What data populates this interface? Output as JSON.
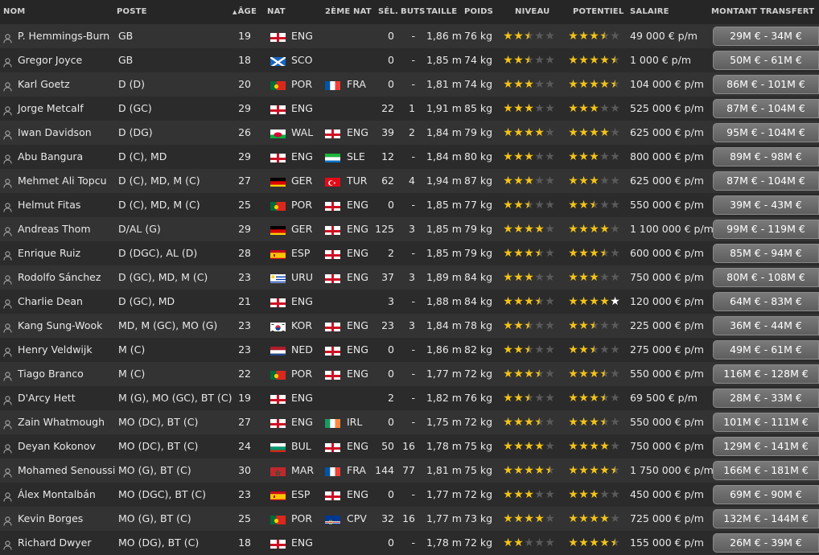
{
  "headers": {
    "nom": "NOM",
    "poste": "POSTE",
    "age": "ÂGE",
    "nat": "NAT",
    "nat2": "2ÈME NAT",
    "sel": "SÉL.",
    "buts": "BUTS",
    "taille": "TAILLE",
    "poids": "POIDS",
    "niveau": "NIVEAU",
    "potentiel": "POTENTIEL",
    "salaire": "SALAIRE",
    "montant": "MONTANT TRANSFERT"
  },
  "colors": {
    "star": "#f3c319",
    "star_empty": "#5a5a5a",
    "row_odd": "#333333",
    "row_even": "#2b2b2b"
  },
  "players": [
    {
      "name": "P. Hemmings-Burn",
      "pos": "GB",
      "age": "19",
      "nat": "ENG",
      "nat2": "",
      "sel": "0",
      "buts": "-",
      "taille": "1,86 m",
      "poids": "76 kg",
      "niveau": 2.5,
      "potentiel": 3.5,
      "salaire": "49 000 € p/m",
      "montant": "29M € - 34M €"
    },
    {
      "name": "Gregor Joyce",
      "pos": "GB",
      "age": "18",
      "nat": "SCO",
      "nat2": "",
      "sel": "0",
      "buts": "-",
      "taille": "1,85 m",
      "poids": "74 kg",
      "niveau": 2.5,
      "potentiel": 4.5,
      "salaire": "1 000 € p/m",
      "montant": "50M € - 61M €"
    },
    {
      "name": "Karl Goetz",
      "pos": "D (D)",
      "age": "20",
      "nat": "POR",
      "nat2": "FRA",
      "sel": "0",
      "buts": "-",
      "taille": "1,81 m",
      "poids": "74 kg",
      "niveau": 3,
      "potentiel": 4.5,
      "salaire": "104 000 € p/m",
      "montant": "86M € - 101M €"
    },
    {
      "name": "Jorge Metcalf",
      "pos": "D (GC)",
      "age": "29",
      "nat": "ENG",
      "nat2": "",
      "sel": "22",
      "buts": "1",
      "taille": "1,91 m",
      "poids": "85 kg",
      "niveau": 3,
      "potentiel": 3,
      "salaire": "525 000 € p/m",
      "montant": "87M € - 104M €"
    },
    {
      "name": "Iwan Davidson",
      "pos": "D (DG)",
      "age": "26",
      "nat": "WAL",
      "nat2": "ENG",
      "sel": "39",
      "buts": "2",
      "taille": "1,84 m",
      "poids": "79 kg",
      "niveau": 4,
      "potentiel": 4,
      "salaire": "625 000 € p/m",
      "montant": "95M € - 104M €"
    },
    {
      "name": "Abu Bangura",
      "pos": "D (C), MD",
      "age": "29",
      "nat": "ENG",
      "nat2": "SLE",
      "sel": "12",
      "buts": "-",
      "taille": "1,84 m",
      "poids": "80 kg",
      "niveau": 3,
      "potentiel": 3,
      "salaire": "800 000 € p/m",
      "montant": "89M € - 98M €"
    },
    {
      "name": "Mehmet Ali Topcu",
      "pos": "D (C), MD, M (C)",
      "age": "27",
      "nat": "GER",
      "nat2": "TUR",
      "sel": "62",
      "buts": "4",
      "taille": "1,94 m",
      "poids": "87 kg",
      "niveau": 3,
      "potentiel": 3,
      "salaire": "625 000 € p/m",
      "montant": "87M € - 104M €"
    },
    {
      "name": "Helmut Fitas",
      "pos": "D (C), MD, M (C)",
      "age": "25",
      "nat": "POR",
      "nat2": "ENG",
      "sel": "0",
      "buts": "-",
      "taille": "1,85 m",
      "poids": "77 kg",
      "niveau": 2.5,
      "potentiel": 2.5,
      "salaire": "550 000 € p/m",
      "montant": "39M € - 43M €"
    },
    {
      "name": "Andreas Thom",
      "pos": "D/AL (G)",
      "age": "29",
      "nat": "GER",
      "nat2": "ENG",
      "sel": "125",
      "buts": "3",
      "taille": "1,85 m",
      "poids": "79 kg",
      "niveau": 4,
      "potentiel": 4,
      "salaire": "1 100 000 € p/m",
      "montant": "99M € - 119M €"
    },
    {
      "name": "Enrique Ruiz",
      "pos": "D (DGC), AL (D)",
      "age": "28",
      "nat": "ESP",
      "nat2": "ENG",
      "sel": "2",
      "buts": "-",
      "taille": "1,85 m",
      "poids": "79 kg",
      "niveau": 3.5,
      "potentiel": 3.5,
      "salaire": "600 000 € p/m",
      "montant": "85M € - 94M €"
    },
    {
      "name": "Rodolfo Sánchez",
      "pos": "D (GC), MD, M (C)",
      "age": "23",
      "nat": "URU",
      "nat2": "ENG",
      "sel": "37",
      "buts": "3",
      "taille": "1,89 m",
      "poids": "84 kg",
      "niveau": 3,
      "potentiel": 3,
      "salaire": "750 000 € p/m",
      "montant": "80M € - 108M €"
    },
    {
      "name": "Charlie Dean",
      "pos": "D (GC), MD",
      "age": "21",
      "nat": "ENG",
      "nat2": "",
      "sel": "3",
      "buts": "-",
      "taille": "1,88 m",
      "poids": "84 kg",
      "niveau": 3.5,
      "potentiel": 4,
      "salaire": "120 000 € p/m",
      "montant": "64M € - 83M €"
    },
    {
      "name": "Kang Sung-Wook",
      "pos": "MD, M (GC), MO (G)",
      "age": "23",
      "nat": "KOR",
      "nat2": "ENG",
      "sel": "23",
      "buts": "3",
      "taille": "1,84 m",
      "poids": "78 kg",
      "niveau": 2.5,
      "potentiel": 2.5,
      "salaire": "225 000 € p/m",
      "montant": "36M € - 44M €"
    },
    {
      "name": "Henry Veldwijk",
      "pos": "M (C)",
      "age": "23",
      "nat": "NED",
      "nat2": "ENG",
      "sel": "0",
      "buts": "-",
      "taille": "1,86 m",
      "poids": "82 kg",
      "niveau": 2.5,
      "potentiel": 2.5,
      "salaire": "275 000 € p/m",
      "montant": "49M € - 61M €"
    },
    {
      "name": "Tiago Branco",
      "pos": "M (C)",
      "age": "22",
      "nat": "POR",
      "nat2": "ENG",
      "sel": "0",
      "buts": "-",
      "taille": "1,77 m",
      "poids": "72 kg",
      "niveau": 3.5,
      "potentiel": 3.5,
      "salaire": "550 000 € p/m",
      "montant": "116M € - 128M €"
    },
    {
      "name": "D'Arcy Hett",
      "pos": "M (G), MO (GC), BT (C)",
      "age": "19",
      "nat": "ENG",
      "nat2": "",
      "sel": "2",
      "buts": "-",
      "taille": "1,82 m",
      "poids": "76 kg",
      "niveau": 2.5,
      "potentiel": 3.5,
      "salaire": "69 500 € p/m",
      "montant": "28M € - 33M €"
    },
    {
      "name": "Zain Whatmough",
      "pos": "MO (DC), BT (C)",
      "age": "27",
      "nat": "ENG",
      "nat2": "IRL",
      "sel": "0",
      "buts": "-",
      "taille": "1,75 m",
      "poids": "72 kg",
      "niveau": 3.5,
      "potentiel": 3.5,
      "salaire": "550 000 € p/m",
      "montant": "101M € - 111M €"
    },
    {
      "name": "Deyan Kokonov",
      "pos": "MO (DC), BT (C)",
      "age": "24",
      "nat": "BUL",
      "nat2": "ENG",
      "sel": "50",
      "buts": "16",
      "taille": "1,78 m",
      "poids": "75 kg",
      "niveau": 4,
      "potentiel": 4,
      "salaire": "750 000 € p/m",
      "montant": "129M € - 141M €"
    },
    {
      "name": "Mohamed Senoussi",
      "pos": "MO (G), BT (C)",
      "age": "30",
      "nat": "MAR",
      "nat2": "FRA",
      "sel": "144",
      "buts": "77",
      "taille": "1,81 m",
      "poids": "75 kg",
      "niveau": 4.5,
      "potentiel": 4.5,
      "salaire": "1 750 000 € p/m",
      "montant": "166M € - 181M €"
    },
    {
      "name": "Álex Montalbán",
      "pos": "MO (DGC), BT (C)",
      "age": "23",
      "nat": "ESP",
      "nat2": "ENG",
      "sel": "0",
      "buts": "-",
      "taille": "1,77 m",
      "poids": "72 kg",
      "niveau": 3,
      "potentiel": 3,
      "salaire": "450 000 € p/m",
      "montant": "69M € - 90M €"
    },
    {
      "name": "Kevin Borges",
      "pos": "MO (G), BT (C)",
      "age": "25",
      "nat": "POR",
      "nat2": "CPV",
      "sel": "32",
      "buts": "16",
      "taille": "1,77 m",
      "poids": "73 kg",
      "niveau": 4,
      "potentiel": 4,
      "salaire": "725 000 € p/m",
      "montant": "132M € - 144M €"
    },
    {
      "name": "Richard Dwyer",
      "pos": "MO (DG), BT (C)",
      "age": "18",
      "nat": "ENG",
      "nat2": "",
      "sel": "0",
      "buts": "-",
      "taille": "1,78 m",
      "poids": "72 kg",
      "niveau": 2,
      "potentiel": 4.5,
      "salaire": "155 000 € p/m",
      "montant": "26M € - 39M €"
    }
  ]
}
